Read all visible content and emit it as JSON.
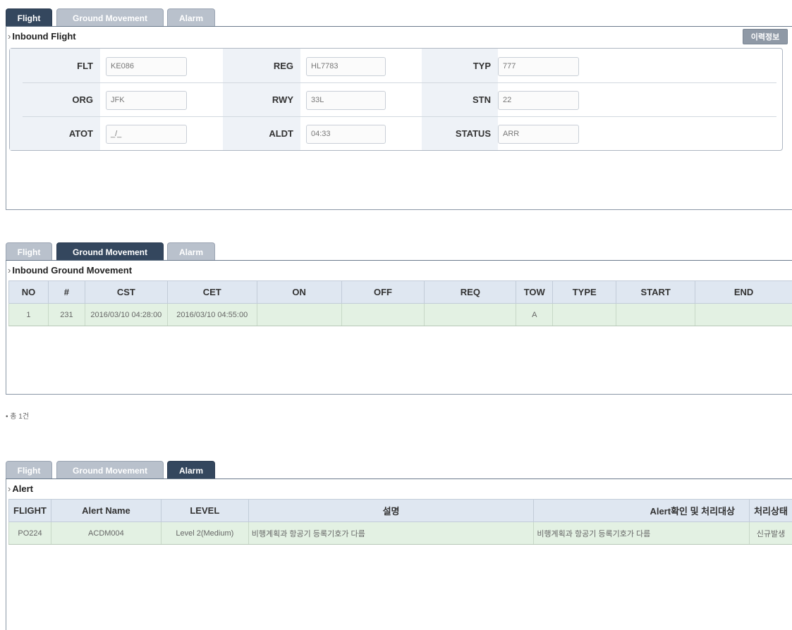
{
  "tabs": {
    "flight": "Flight",
    "ground_movement": "Ground Movement",
    "alarm": "Alarm"
  },
  "flight_panel": {
    "title": "Inbound Flight",
    "history_button": "이력정보",
    "fields": {
      "flt": {
        "label": "FLT",
        "value": "KE086"
      },
      "reg": {
        "label": "REG",
        "value": "HL7783"
      },
      "typ": {
        "label": "TYP",
        "value": "777"
      },
      "org": {
        "label": "ORG",
        "value": "JFK"
      },
      "rwy": {
        "label": "RWY",
        "value": "33L"
      },
      "stn": {
        "label": "STN",
        "value": "22"
      },
      "atot": {
        "label": "ATOT",
        "value": "_/_"
      },
      "aldt": {
        "label": "ALDT",
        "value": "04:33"
      },
      "status": {
        "label": "STATUS",
        "value": "ARR"
      }
    }
  },
  "ground_panel": {
    "title": "Inbound Ground Movement",
    "columns": [
      "NO",
      "#",
      "CST",
      "CET",
      "ON",
      "OFF",
      "REQ",
      "TOW",
      "TYPE",
      "START",
      "END"
    ],
    "rows": [
      [
        "1",
        "231",
        "2016/03/10 04:28:00",
        "2016/03/10 04:55:00",
        "",
        "",
        "",
        "A",
        "",
        "",
        ""
      ]
    ],
    "total": "• 총 1건"
  },
  "alarm_panel": {
    "title": "Alert",
    "columns": [
      "FLIGHT",
      "Alert Name",
      "LEVEL",
      "설명",
      "Alert확인 및 처리대상",
      "처리상태"
    ],
    "rows": [
      [
        "PO224",
        "ACDM004",
        "Level 2(Medium)",
        "비행계획과 항공기 등록기호가 다름",
        "비행계획과 항공기 등록기호가 다름",
        "신규발생"
      ]
    ]
  }
}
